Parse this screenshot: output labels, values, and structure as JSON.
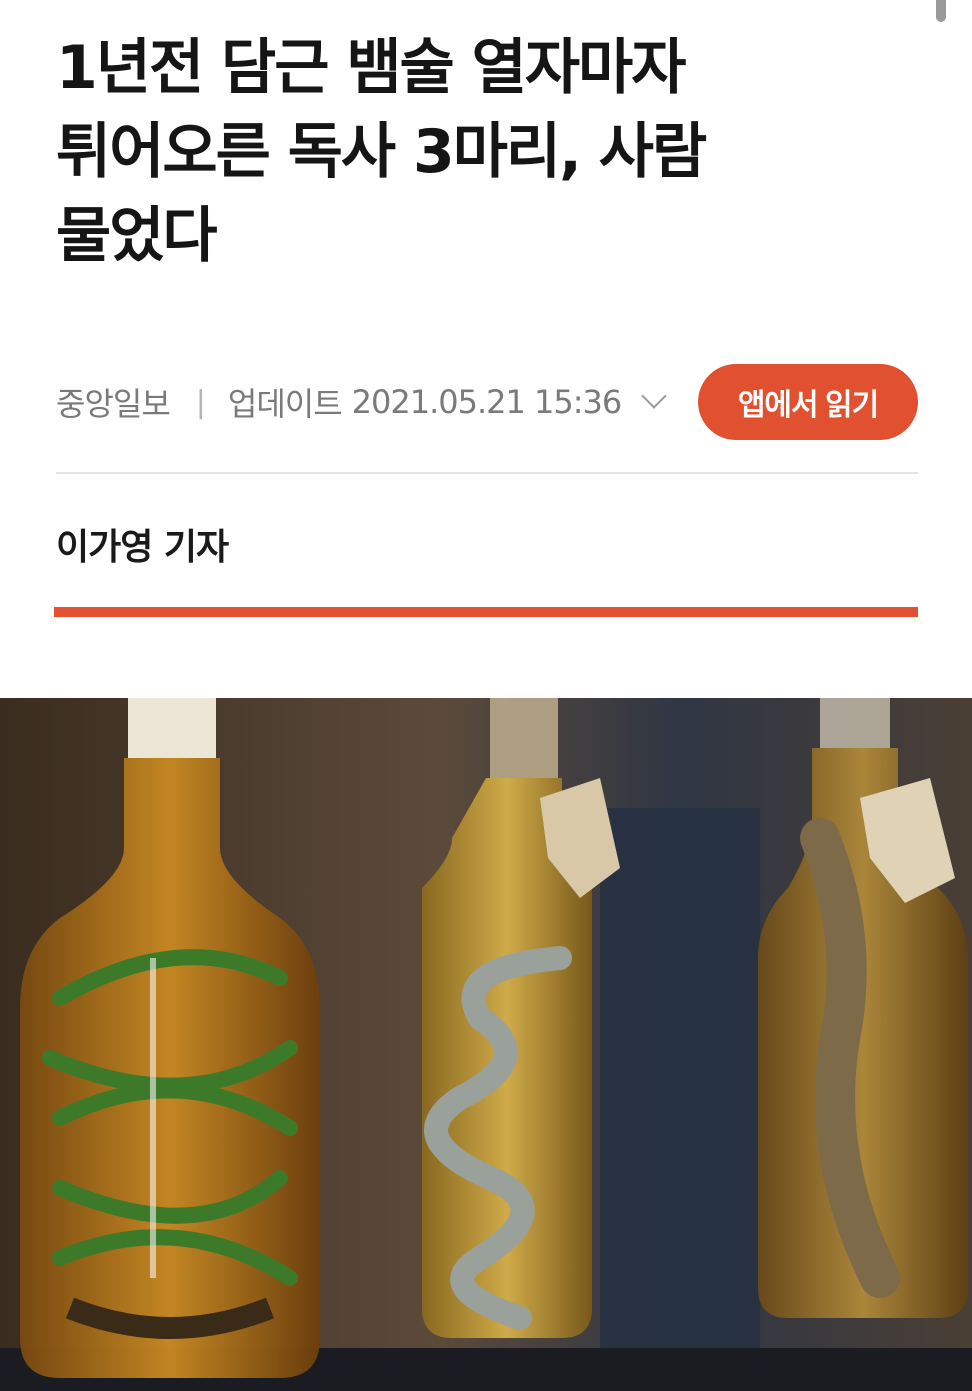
{
  "article": {
    "headline_lines": [
      "1년전 담근 뱀술 열자마자",
      "튀어오른 독사 3마리, 사람",
      "물었다"
    ],
    "source": "중앙일보",
    "separator": "|",
    "updated_label": "업데이트",
    "updated_datetime": "2021.05.21 15:36",
    "app_button_label": "앱에서 읽기",
    "byline": "이가영 기자"
  },
  "colors": {
    "accent": "#e1502f",
    "meta_text": "#7a7a7a",
    "headline": "#151515"
  },
  "icons": {
    "expand": "chevron-down-icon"
  }
}
